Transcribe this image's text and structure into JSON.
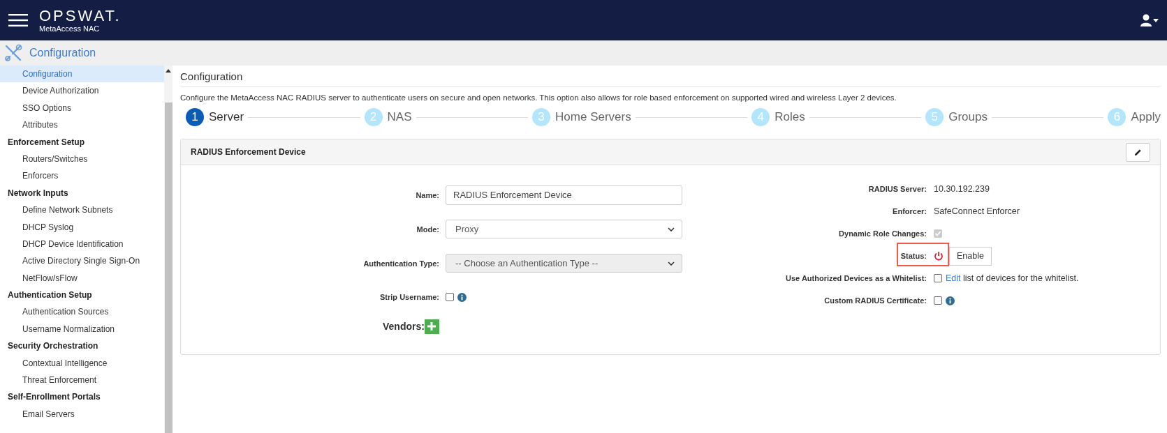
{
  "header": {
    "brand": "OPSWAT.",
    "product": "MetaAccess NAC"
  },
  "section_bar": {
    "title": "Configuration"
  },
  "sidebar": {
    "items": [
      {
        "label": "Configuration",
        "kind": "item",
        "selected": true
      },
      {
        "label": "Device Authorization",
        "kind": "item",
        "selected": false
      },
      {
        "label": "SSO Options",
        "kind": "item",
        "selected": false
      },
      {
        "label": "Attributes",
        "kind": "item",
        "selected": false
      },
      {
        "label": "Enforcement Setup",
        "kind": "group",
        "selected": false
      },
      {
        "label": "Routers/Switches",
        "kind": "item",
        "selected": false
      },
      {
        "label": "Enforcers",
        "kind": "item",
        "selected": false
      },
      {
        "label": "Network Inputs",
        "kind": "group",
        "selected": false
      },
      {
        "label": "Define Network Subnets",
        "kind": "item",
        "selected": false
      },
      {
        "label": "DHCP Syslog",
        "kind": "item",
        "selected": false
      },
      {
        "label": "DHCP Device Identification",
        "kind": "item",
        "selected": false
      },
      {
        "label": "Active Directory Single Sign-On",
        "kind": "item",
        "selected": false
      },
      {
        "label": "NetFlow/sFlow",
        "kind": "item",
        "selected": false
      },
      {
        "label": "Authentication Setup",
        "kind": "group",
        "selected": false
      },
      {
        "label": "Authentication Sources",
        "kind": "item",
        "selected": false
      },
      {
        "label": "Username Normalization",
        "kind": "item",
        "selected": false
      },
      {
        "label": "Security Orchestration",
        "kind": "group",
        "selected": false
      },
      {
        "label": "Contextual Intelligence",
        "kind": "item",
        "selected": false
      },
      {
        "label": "Threat Enforcement",
        "kind": "item",
        "selected": false
      },
      {
        "label": "Self-Enrollment Portals",
        "kind": "group",
        "selected": false
      },
      {
        "label": "Email Servers",
        "kind": "item",
        "selected": false
      }
    ]
  },
  "page": {
    "title": "Configuration",
    "description": "Configure the MetaAccess NAC RADIUS server to authenticate users on secure and open networks. This option also allows for role based enforcement on supported wired and wireless Layer 2 devices."
  },
  "steps": [
    {
      "number": "1",
      "label": "Server",
      "selected": true
    },
    {
      "number": "2",
      "label": "NAS",
      "selected": false
    },
    {
      "number": "3",
      "label": "Home Servers",
      "selected": false
    },
    {
      "number": "4",
      "label": "Roles",
      "selected": false
    },
    {
      "number": "5",
      "label": "Groups",
      "selected": false
    },
    {
      "number": "6",
      "label": "Apply",
      "selected": false
    }
  ],
  "card": {
    "title": "RADIUS Enforcement Device",
    "left_fields": [
      {
        "kind": "input",
        "label": "Name:",
        "value": "RADIUS Enforcement Device"
      },
      {
        "kind": "select",
        "label": "Mode:",
        "value": "Proxy",
        "disabled": false
      },
      {
        "kind": "select",
        "label": "Authentication Type:",
        "value": "-- Choose an Authentication Type --",
        "disabled": true
      },
      {
        "kind": "checkbox",
        "label": "Strip Username:",
        "checked": false,
        "disabled": false,
        "info": true
      },
      {
        "kind": "add",
        "label": "Vendors:"
      }
    ],
    "right_fields": [
      {
        "kind": "text",
        "label": "RADIUS Server:",
        "value": "10.30.192.239"
      },
      {
        "kind": "text",
        "label": "Enforcer:",
        "value": "SafeConnect Enforcer"
      },
      {
        "kind": "checkbox",
        "label": "Dynamic Role Changes:",
        "checked": true,
        "disabled": true
      },
      {
        "kind": "status",
        "label": "Status:",
        "on": false,
        "button": "Enable",
        "highlighted": true
      },
      {
        "kind": "checkbox",
        "label": "Use Authorized Devices as a Whitelist:",
        "checked": false,
        "disabled": false,
        "link": "Edit",
        "after_link": "list of devices for the whitelist."
      },
      {
        "kind": "checkbox",
        "label": "Custom RADIUS Certificate:",
        "checked": false,
        "disabled": false,
        "info": true
      }
    ]
  }
}
